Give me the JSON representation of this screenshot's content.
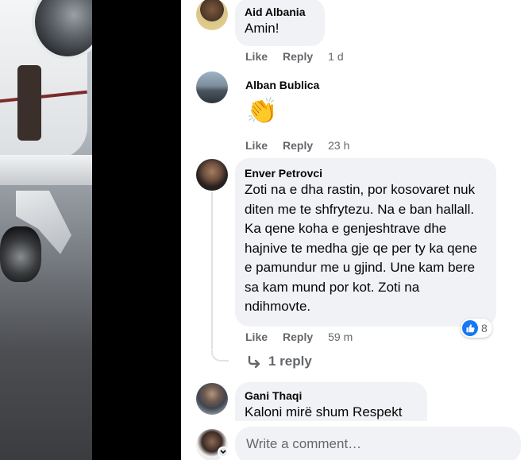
{
  "comments": [
    {
      "author": "Aid Albania",
      "text": "Amin!",
      "like_label": "Like",
      "reply_label": "Reply",
      "time": "1 d"
    },
    {
      "author": "Alban Bublica",
      "text": "👏",
      "like_label": "Like",
      "reply_label": "Reply",
      "time": "23 h"
    },
    {
      "author": "Enver Petrovci",
      "text": "Zoti na e dha rastin, por kosovaret nuk diten me te shfrytezu. Na e ban hallall. Ka qene koha e genjeshtrave dhe hajnive te medha gje qe per ty ka qene e pamundur me u gjind. Une kam bere sa kam mund por kot. Zoti na ndihmovte.",
      "like_label": "Like",
      "reply_label": "Reply",
      "time": "59 m",
      "reaction_count": "8",
      "replies_label": "1 reply"
    },
    {
      "author": "Gani Thaqi",
      "text": "Kaloni mirë shum Respekt"
    }
  ],
  "composer": {
    "placeholder": "Write a comment…"
  },
  "colors": {
    "like_blue": "#1877f2",
    "bubble_bg": "#f0f2f5",
    "muted_text": "#65676b"
  }
}
